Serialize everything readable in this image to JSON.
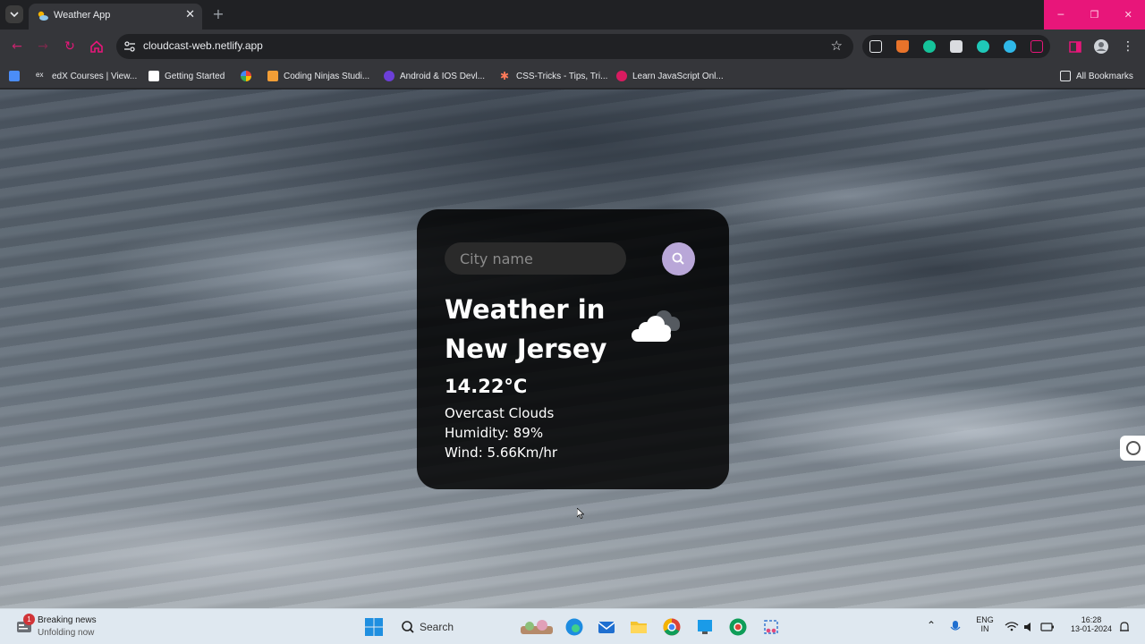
{
  "browser": {
    "tab": {
      "title": "Weather App"
    },
    "address": {
      "url": "cloudcast-web.netlify.app"
    },
    "bookmarks": [
      "edX Courses | View...",
      "Getting Started",
      "Coding Ninjas Studi...",
      "Android & IOS Devl...",
      "CSS-Tricks - Tips, Tri...",
      "Learn JavaScript Onl..."
    ],
    "all_bookmarks": "All Bookmarks"
  },
  "weather": {
    "search_placeholder": "City name",
    "title": "Weather in New Jersey",
    "temperature": "14.22°C",
    "description": "Overcast Clouds",
    "humidity": "Humidity: 89%",
    "wind": "Wind: 5.66Km/hr",
    "icon": "cloud-icon"
  },
  "taskbar": {
    "news_badge": "1",
    "news_title": "Breaking news",
    "news_subtitle": "Unfolding now",
    "search_label": "Search",
    "lang_primary": "ENG",
    "lang_secondary": "IN",
    "time": "16:28",
    "date": "13-01-2024"
  },
  "colors": {
    "card_bg": "#000000",
    "search_button": "#b9a7d8",
    "window_controls": "#e8167a"
  }
}
